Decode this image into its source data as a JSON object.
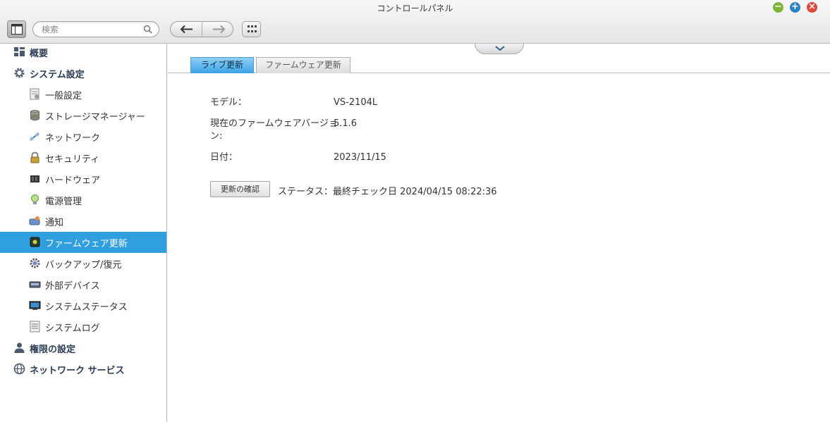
{
  "window": {
    "title": "コントロールパネル"
  },
  "toolbar": {
    "search_placeholder": "検索"
  },
  "sidebar": {
    "items": [
      {
        "label": "概要",
        "level": "top",
        "icon": "overview-grid-icon"
      },
      {
        "label": "システム設定",
        "level": "top",
        "icon": "gear-icon"
      },
      {
        "label": "一般設定",
        "level": "sub",
        "icon": "general-settings-icon"
      },
      {
        "label": "ストレージマネージャー",
        "level": "sub",
        "icon": "storage-disks-icon"
      },
      {
        "label": "ネットワーク",
        "level": "sub",
        "icon": "network-icon"
      },
      {
        "label": "セキュリティ",
        "level": "sub",
        "icon": "lock-icon"
      },
      {
        "label": "ハードウェア",
        "level": "sub",
        "icon": "hardware-icon"
      },
      {
        "label": "電源管理",
        "level": "sub",
        "icon": "lightbulb-icon"
      },
      {
        "label": "通知",
        "level": "sub",
        "icon": "notification-icon"
      },
      {
        "label": "ファームウェア更新",
        "level": "sub",
        "icon": "firmware-chip-icon",
        "active": true
      },
      {
        "label": "バックアップ/復元",
        "level": "sub",
        "icon": "backup-restore-icon"
      },
      {
        "label": "外部デバイス",
        "level": "sub",
        "icon": "external-device-icon"
      },
      {
        "label": "システムステータス",
        "level": "sub",
        "icon": "monitor-icon"
      },
      {
        "label": "システムログ",
        "level": "sub",
        "icon": "log-icon"
      },
      {
        "label": "権限の設定",
        "level": "top",
        "icon": "user-icon"
      },
      {
        "label": "ネットワーク サービス",
        "level": "top",
        "icon": "globe-icon"
      }
    ]
  },
  "main": {
    "tabs": [
      {
        "label": "ライブ更新",
        "active": true
      },
      {
        "label": "ファームウェア更新",
        "active": false
      }
    ],
    "info": {
      "model_label": "モデル：",
      "model_value": "VS-2104L",
      "firmware_label_line1": "現在のファームウェアバージョ",
      "firmware_label_line2": "ン:",
      "firmware_value": "5.1.6",
      "date_label": "日付：",
      "date_value": "2023/11/15"
    },
    "check_button_label": "更新の確認",
    "status_text": "ステータス：最終チェック日 2024/04/15 08:22:36"
  },
  "colors": {
    "accent": "#2f9fe0",
    "minimize": "#7fb43a",
    "maximize": "#2a82c8",
    "close": "#e2463b"
  }
}
